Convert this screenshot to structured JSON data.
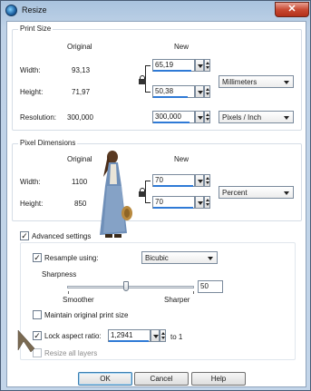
{
  "window": {
    "title": "Resize",
    "close_glyph": "✕"
  },
  "print_size": {
    "legend": "Print Size",
    "col_original": "Original",
    "col_new": "New",
    "width_label": "Width:",
    "width_original": "93,13",
    "width_new": "65,19",
    "height_label": "Height:",
    "height_original": "71,97",
    "height_new": "50,38",
    "unit": "Millimeters",
    "resolution_label": "Resolution:",
    "resolution_original": "300,000",
    "resolution_new": "300,000",
    "resolution_unit": "Pixels / Inch"
  },
  "pixel_dimensions": {
    "legend": "Pixel Dimensions",
    "col_original": "Original",
    "col_new": "New",
    "width_label": "Width:",
    "width_original": "1100",
    "width_new": "70",
    "height_label": "Height:",
    "height_original": "850",
    "height_new": "70",
    "unit": "Percent"
  },
  "advanced": {
    "advanced_settings_label": "Advanced settings",
    "advanced_settings_checked": true,
    "resample_label": "Resample using:",
    "resample_checked": true,
    "resample_method": "Bicubic",
    "sharpness_label": "Sharpness",
    "sharpness_value": "50",
    "smoother_label": "Smoother",
    "sharper_label": "Sharper",
    "maintain_label": "Maintain original print size",
    "maintain_checked": false,
    "lock_ratio_label": "Lock aspect ratio:",
    "lock_ratio_checked": true,
    "ratio_value": "1,2941",
    "ratio_suffix": "to 1",
    "resize_layers_label": "Resize all layers",
    "resize_layers_checked": false
  },
  "buttons": {
    "ok": "OK",
    "cancel": "Cancel",
    "help": "Help"
  },
  "icons": {
    "app": "paint-shop-icon",
    "lock": "lock-icon",
    "arrow": "pointer-arrow-icon",
    "figure": "woman-figure-tube-image"
  },
  "colors": {
    "accent": "#2f7ad6",
    "close": "#c94a33"
  }
}
